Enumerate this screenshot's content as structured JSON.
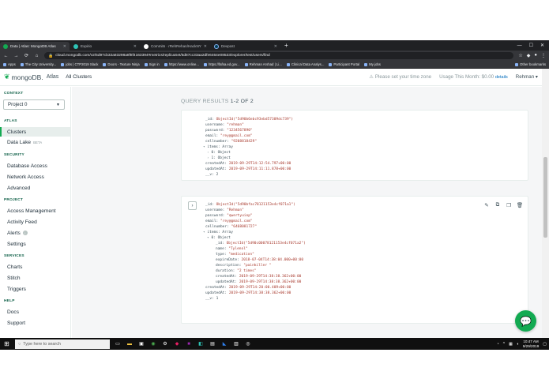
{
  "browser": {
    "tabs": [
      {
        "title": "Data | Atlas: MongoDB Atlas",
        "active": true,
        "color": "#13aa52"
      },
      {
        "title": "Expirio",
        "active": false,
        "color": "#2ec4b6"
      },
      {
        "title": "Commits · rRehRehan/HackNY",
        "active": false,
        "color": "#ffffff"
      },
      {
        "title": "Devpost",
        "active": false,
        "color": "#003e54"
      }
    ],
    "new_tab": "+",
    "url": "cloud.mongodb.com/v2/5d97cb32a83298a8f8f4163394#metrics/replicaSet/5d87cc33aa2dfe6464e08533/explorer/test/users/find",
    "bookmarks": [
      "Apps",
      "The City University...",
      "jobs | CTP2019 Slack",
      "Doors - Texture Ninja",
      "Sign in",
      "https://www.online...",
      "https://fafsa.ed.gov...",
      "Rehman Arshad | Li...",
      "Clinical Data Analys...",
      "Participant Portal",
      "My jobs"
    ],
    "other_bookmarks": "Other bookmarks"
  },
  "header": {
    "logo": "mongoDB.",
    "logo_sub": "Atlas",
    "org": "All Clusters",
    "timezone": "Please set your time zone",
    "usage": "Usage This Month: $0.00",
    "details": "details",
    "user": "Rehman"
  },
  "sidebar": {
    "context_label": "CONTEXT",
    "project": "Project 0",
    "atlas_label": "ATLAS",
    "clusters": "Clusters",
    "data_lake": "Data Lake",
    "beta": "BETA",
    "security_label": "SECURITY",
    "database_access": "Database Access",
    "network_access": "Network Access",
    "advanced": "Advanced",
    "project_label": "PROJECT",
    "access_management": "Access Management",
    "activity_feed": "Activity Feed",
    "alerts": "Alerts",
    "settings": "Settings",
    "services_label": "SERVICES",
    "charts": "Charts",
    "stitch": "Stitch",
    "triggers": "Triggers",
    "help_label": "HELP",
    "docs": "Docs",
    "support": "Support"
  },
  "results": {
    "label": "QUERY RESULTS",
    "count": "1-2 OF 2"
  },
  "doc1": {
    "id_key": "_id:",
    "id_val": "ObjectId(\"5d90b6ebc93ebd57309dc739\")",
    "username_key": "username:",
    "username_val": "\"rehman\"",
    "password_key": "password:",
    "password_val": "\"1234567890\"",
    "email_key": "email:",
    "email_val": "\"rey@gmail.com\"",
    "cell_key": "cellnumber:",
    "cell_val": "\"9208818429\"",
    "items_key": "items:",
    "items_val": "Array",
    "item0": "0: Object",
    "item1": "1: Object",
    "created_key": "createdAt:",
    "created_val": "2019-09-29T14:12:54.797+00:00",
    "updated_key": "updatedAt:",
    "updated_val": "2019-09-29T14:11:11.878+00:00",
    "v_key": "__v:",
    "v_val": "2"
  },
  "doc2": {
    "expand": "›",
    "id_key": "_id:",
    "id_val": "ObjectId(\"5d90bfac78121153e4cf071a1\")",
    "username_key": "username:",
    "username_val": "\"Rehman\"",
    "password_key": "password:",
    "password_val": "\"qwertyuiop\"",
    "email_key": "email:",
    "email_val": "\"rey@gmail.com\"",
    "cell_key": "cellnumber:",
    "cell_val": "\"6468081727\"",
    "items_key": "items:",
    "items_val": "Array",
    "item0": "0: Object",
    "sub_id_key": "_id:",
    "sub_id_val": "ObjectId(\"5d90c00078121153e4cf071a2\")",
    "name_key": "name:",
    "name_val": "\"Tylenol\"",
    "type_key": "type:",
    "type_val": "\"medication\"",
    "expire_key": "expireDate:",
    "expire_val": "2018-07-04T14:38:04.000+00:00",
    "desc_key": "description:",
    "desc_val": "\"painkiller \"",
    "duration_key": "duration:",
    "duration_val": "\"2 times\"",
    "screated_key": "createdAt:",
    "screated_val": "2019-09-29T14:38:38.362+00:00",
    "supdated_key": "updatedAt:",
    "supdated_val": "2019-09-29T14:38:38.362+00:00",
    "created_key": "createdAt:",
    "created_val": "2019-09-29T14:20:00.409+00:00",
    "updated_key": "updatedAt:",
    "updated_val": "2019-09-29T14:38:38.362+00:00",
    "v_key": "__v:",
    "v_val": "1"
  },
  "taskbar": {
    "search_placeholder": "Type here to search",
    "time": "10:47 AM",
    "date": "9/29/2019"
  },
  "colors": {
    "brand_green": "#13aa52",
    "chrome_dark": "#202124"
  }
}
